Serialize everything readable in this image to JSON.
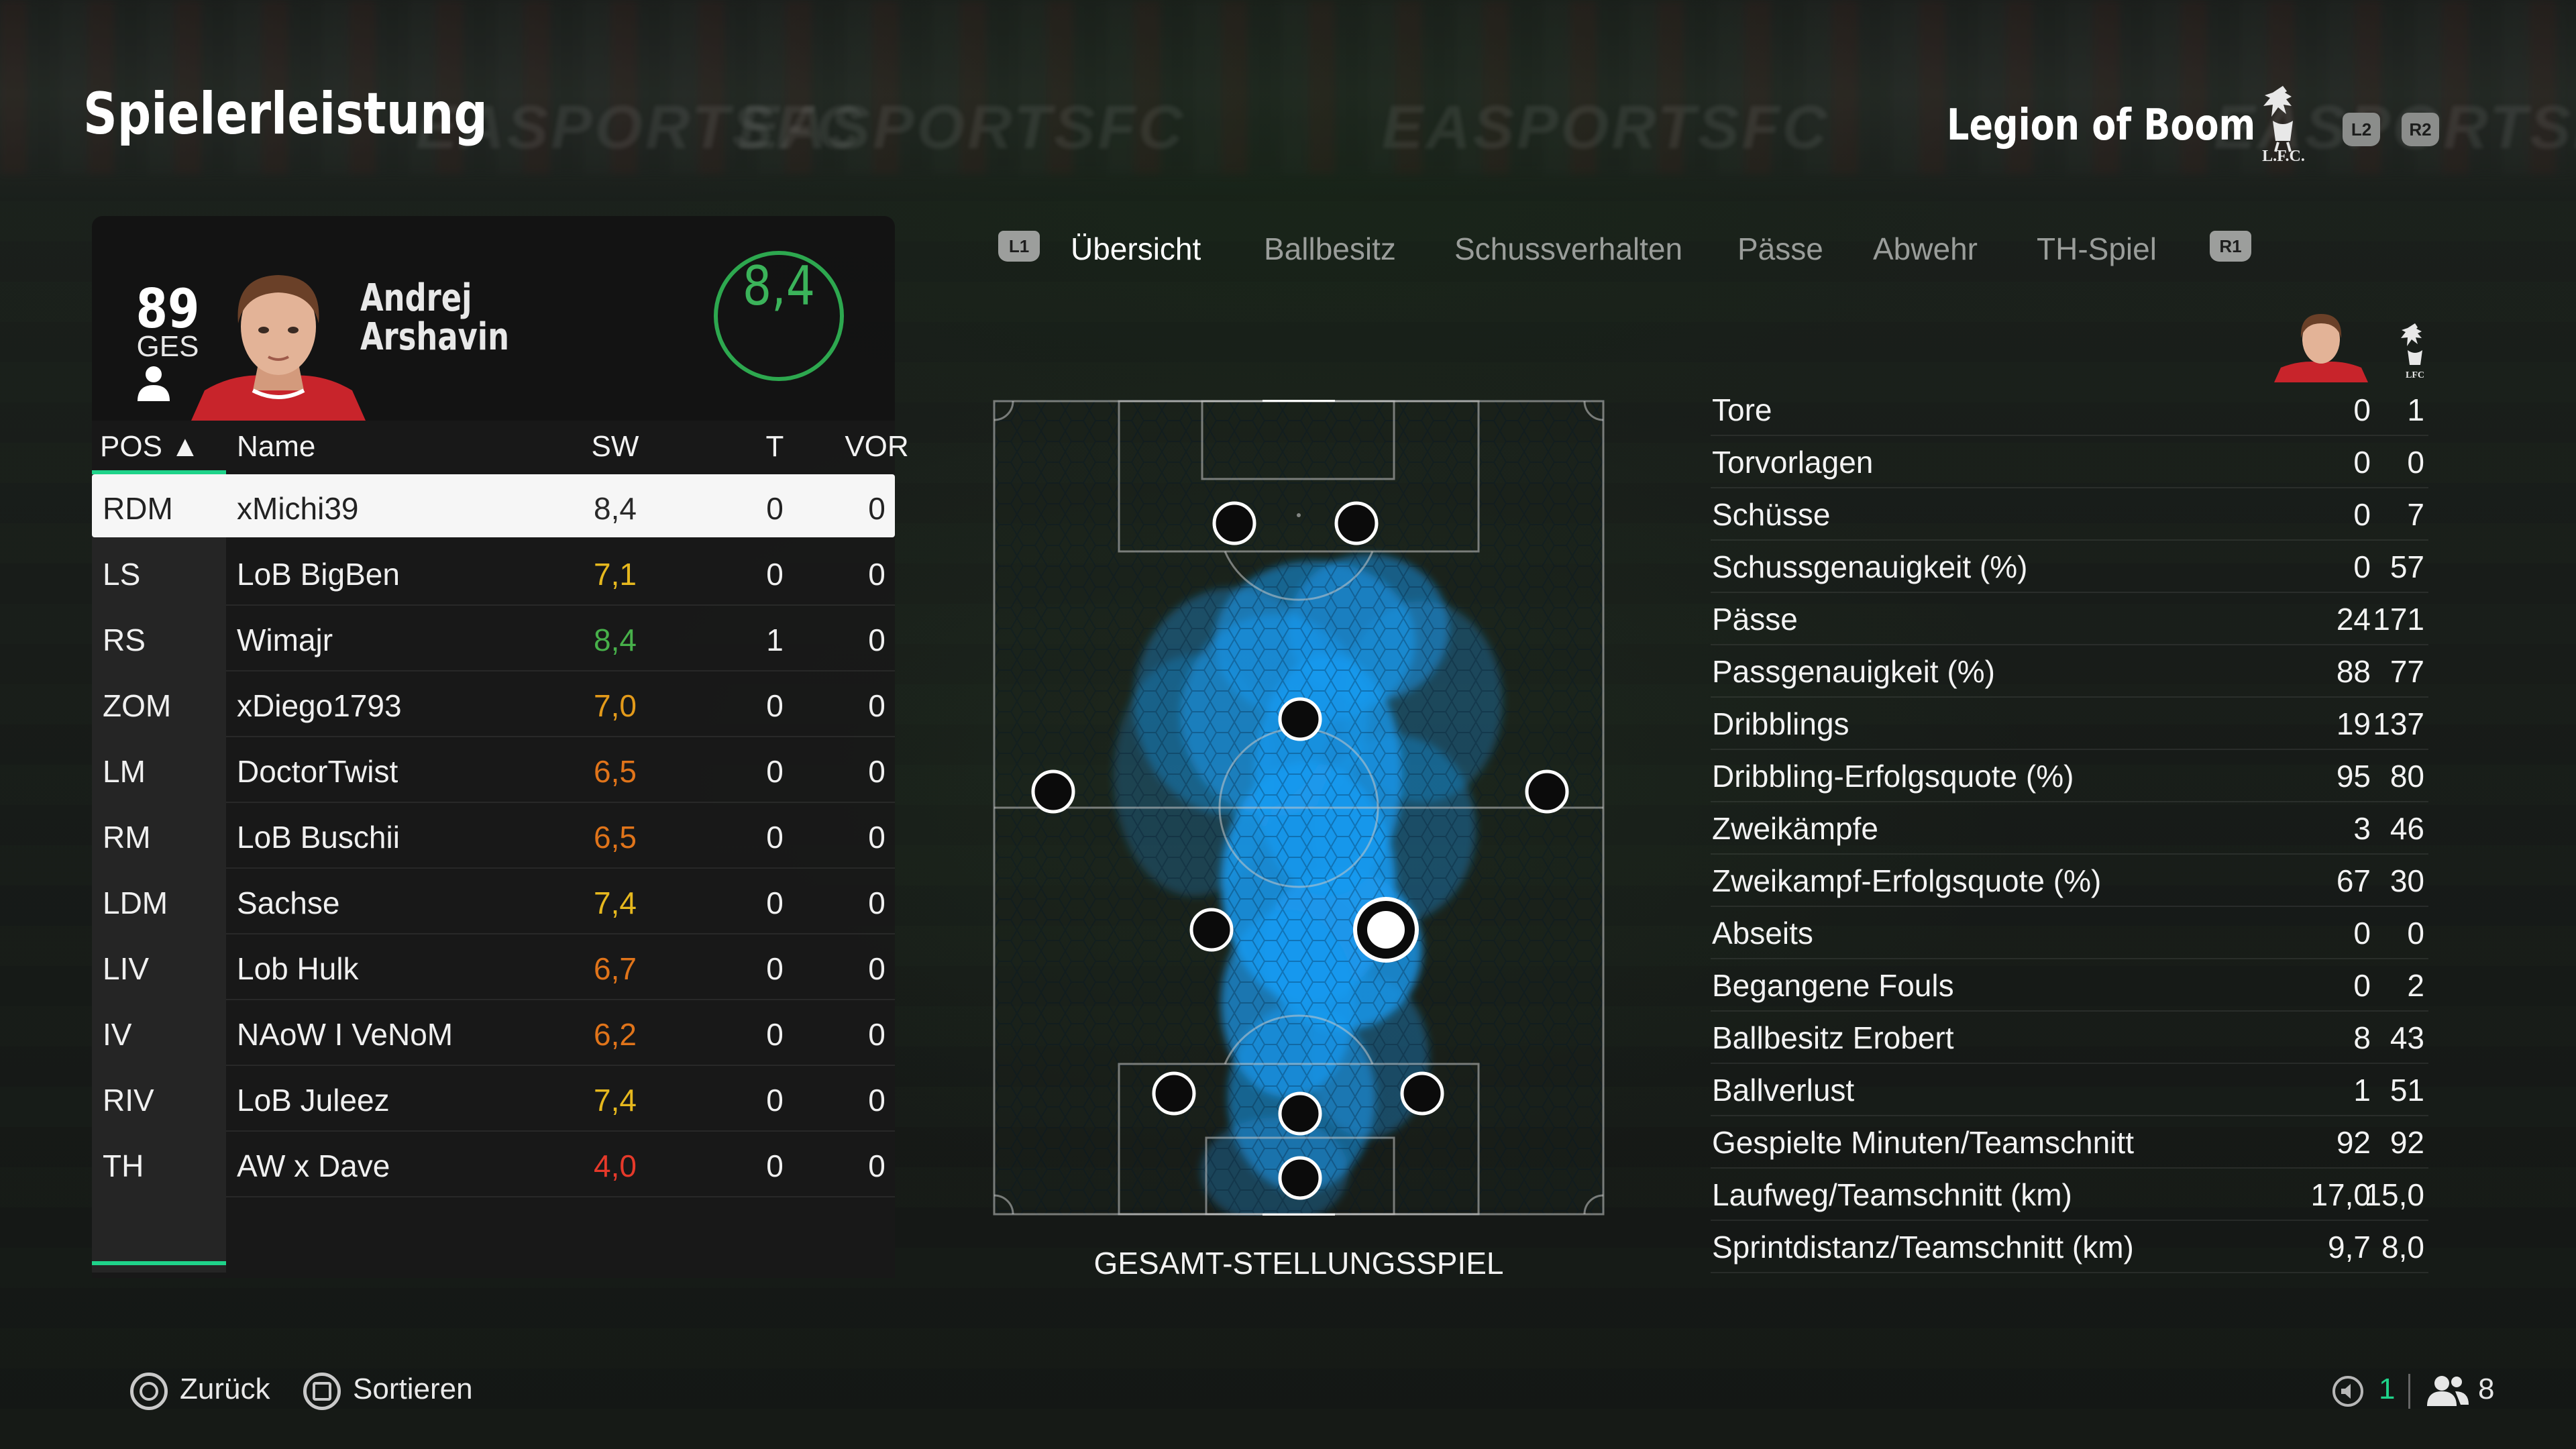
{
  "header": {
    "title": "Spielerleistung",
    "team_name": "Legion of Boom",
    "crest_text": "L.F.C.",
    "l2": "L2",
    "r2": "R2",
    "board_text": [
      "EASPORTSFC",
      "EASPORTSFC",
      "EASPORTSFC",
      "EASPORTSFC"
    ]
  },
  "player": {
    "overall": "89",
    "overall_label": "GES",
    "first_name": "Andrej",
    "last_name": "Arshavin",
    "rating": "8,4"
  },
  "table": {
    "headers": {
      "pos": "POS ▲",
      "name": "Name",
      "sw": "SW",
      "t": "T",
      "vor": "VOR"
    },
    "rows": [
      {
        "pos": "RDM",
        "name": "xMichi39",
        "sw": "8,4",
        "t": "0",
        "vor": "0",
        "color": "#2a2a2a",
        "selected": true
      },
      {
        "pos": "LS",
        "name": "LoB BigBen",
        "sw": "7,1",
        "t": "0",
        "vor": "0",
        "color": "#e6b81e"
      },
      {
        "pos": "RS",
        "name": "Wimajr",
        "sw": "8,4",
        "t": "1",
        "vor": "0",
        "color": "#47b04a"
      },
      {
        "pos": "ZOM",
        "name": "xDiego1793",
        "sw": "7,0",
        "t": "0",
        "vor": "0",
        "color": "#e39a1a"
      },
      {
        "pos": "LM",
        "name": "DoctorTwist",
        "sw": "6,5",
        "t": "0",
        "vor": "0",
        "color": "#e0741a"
      },
      {
        "pos": "RM",
        "name": "LoB Buschii",
        "sw": "6,5",
        "t": "0",
        "vor": "0",
        "color": "#e0741a"
      },
      {
        "pos": "LDM",
        "name": "Sachse",
        "sw": "7,4",
        "t": "0",
        "vor": "0",
        "color": "#e6b81e"
      },
      {
        "pos": "LIV",
        "name": "Lob Hulk",
        "sw": "6,7",
        "t": "0",
        "vor": "0",
        "color": "#e0741a"
      },
      {
        "pos": "IV",
        "name": "NAoW I VeNoM",
        "sw": "6,2",
        "t": "0",
        "vor": "0",
        "color": "#e0741a"
      },
      {
        "pos": "RIV",
        "name": "LoB Juleez",
        "sw": "7,4",
        "t": "0",
        "vor": "0",
        "color": "#e6b81e"
      },
      {
        "pos": "TH",
        "name": "AW x Dave",
        "sw": "4,0",
        "t": "0",
        "vor": "0",
        "color": "#e6392a"
      }
    ]
  },
  "tabs": {
    "l1": "L1",
    "r1": "R1",
    "items": [
      "Übersicht",
      "Ballbesitz",
      "Schussverhalten",
      "Pässe",
      "Abwehr",
      "TH-Spiel"
    ],
    "active": 0
  },
  "pitch": {
    "caption": "GESAMT-STELLUNGSSPIEL",
    "heat_color": "#1a9af0"
  },
  "stats": {
    "rows": [
      {
        "label": "Tore",
        "player": "0",
        "team": "1"
      },
      {
        "label": "Torvorlagen",
        "player": "0",
        "team": "0"
      },
      {
        "label": "Schüsse",
        "player": "0",
        "team": "7"
      },
      {
        "label": "Schussgenauigkeit (%)",
        "player": "0",
        "team": "57"
      },
      {
        "label": "Pässe",
        "player": "24",
        "team": "171"
      },
      {
        "label": "Passgenauigkeit (%)",
        "player": "88",
        "team": "77"
      },
      {
        "label": "Dribblings",
        "player": "19",
        "team": "137"
      },
      {
        "label": "Dribbling-Erfolgsquote (%)",
        "player": "95",
        "team": "80"
      },
      {
        "label": "Zweikämpfe",
        "player": "3",
        "team": "46"
      },
      {
        "label": "Zweikampf-Erfolgsquote (%)",
        "player": "67",
        "team": "30"
      },
      {
        "label": "Abseits",
        "player": "0",
        "team": "0"
      },
      {
        "label": "Begangene Fouls",
        "player": "0",
        "team": "2"
      },
      {
        "label": "Ballbesitz Erobert",
        "player": "8",
        "team": "43"
      },
      {
        "label": "Ballverlust",
        "player": "1",
        "team": "51"
      },
      {
        "label": "Gespielte Minuten/Teamschnitt",
        "player": "92",
        "team": "92"
      },
      {
        "label": "Laufweg/Teamschnitt (km)",
        "player": "17,0",
        "team": "15,0"
      },
      {
        "label": "Sprintdistanz/Teamschnitt (km)",
        "player": "9,7",
        "team": "8,0"
      }
    ],
    "mini_crest_text": "LFC"
  },
  "footer": {
    "back_label": "Zurück",
    "sort_label": "Sortieren",
    "mic_count": "1",
    "party_count": "8",
    "accent": "#1fd38a"
  }
}
